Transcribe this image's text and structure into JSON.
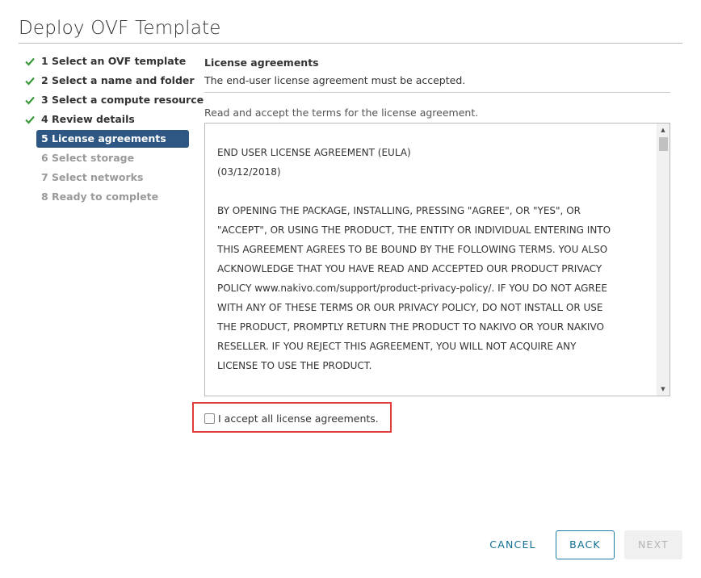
{
  "dialog": {
    "title": "Deploy OVF Template"
  },
  "steps": [
    {
      "label": "1 Select an OVF template",
      "state": "done"
    },
    {
      "label": "2 Select a name and folder",
      "state": "done"
    },
    {
      "label": "3 Select a compute resource",
      "state": "done"
    },
    {
      "label": "4 Review details",
      "state": "done"
    },
    {
      "label": "5 License agreements",
      "state": "active"
    },
    {
      "label": "6 Select storage",
      "state": "pending"
    },
    {
      "label": "7 Select networks",
      "state": "pending"
    },
    {
      "label": "8 Ready to complete",
      "state": "pending"
    }
  ],
  "content": {
    "title": "License agreements",
    "subtitle": "The end-user license agreement must be accepted.",
    "instruction": "Read and accept the terms for the license agreement.",
    "eula": {
      "heading": "END USER LICENSE AGREEMENT (EULA)",
      "date": "(03/12/2018)",
      "body_lines": [
        "BY OPENING THE PACKAGE, INSTALLING, PRESSING \"AGREE\", OR \"YES\", OR",
        "\"ACCEPT\", OR USING THE PRODUCT, THE ENTITY OR INDIVIDUAL ENTERING INTO",
        "THIS AGREEMENT AGREES TO BE BOUND BY THE FOLLOWING TERMS. YOU ALSO",
        "ACKNOWLEDGE THAT YOU HAVE READ AND ACCEPTED OUR PRODUCT PRIVACY",
        "POLICY www.nakivo.com/support/product-privacy-policy/. IF YOU DO NOT AGREE",
        "WITH ANY OF THESE TERMS OR OUR PRIVACY POLICY, DO NOT INSTALL OR USE",
        "THE PRODUCT, PROMPTLY RETURN THE PRODUCT TO NAKIVO OR YOUR NAKIVO",
        "RESELLER. IF YOU REJECT THIS AGREEMENT, YOU WILL NOT ACQUIRE ANY",
        "LICENSE TO USE THE PRODUCT."
      ]
    },
    "accept": {
      "label": "I accept all license agreements.",
      "checked": false
    }
  },
  "footer": {
    "cancel_label": "CANCEL",
    "back_label": "BACK",
    "next_label": "NEXT"
  },
  "colors": {
    "active_step_bg": "#2e5783",
    "check_green": "#3b9a3b",
    "highlight_border": "#e03c3c",
    "link_blue": "#0f6e92"
  },
  "icons": {
    "done_step": "checkmark-icon",
    "scroll_up": "triangle-up-icon",
    "scroll_down": "triangle-down-icon"
  }
}
